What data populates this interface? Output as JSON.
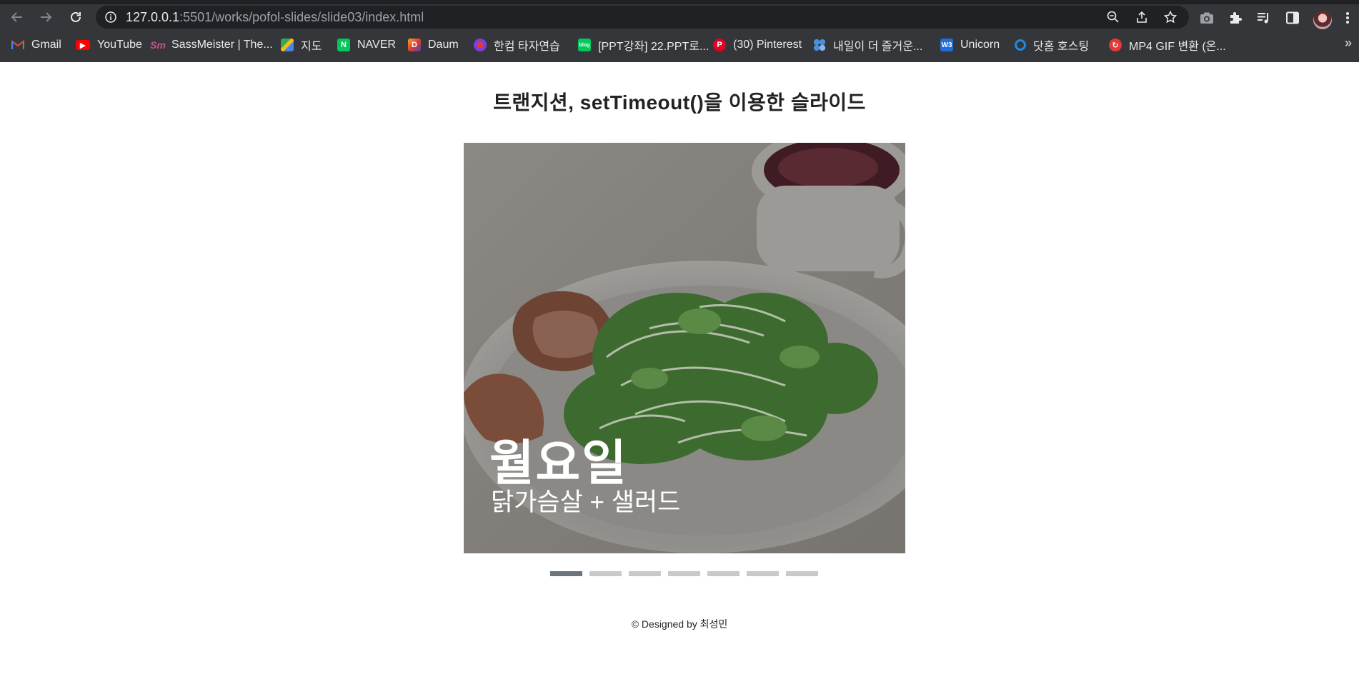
{
  "browser": {
    "url_host": "127.0.0.1",
    "url_rest": ":5501/works/pofol-slides/slide03/index.html",
    "icons": {
      "back": "arrow-left-icon",
      "forward": "arrow-right-icon",
      "reload": "reload-icon",
      "site_info": "info-icon",
      "zoom": "zoom-out-icon",
      "share": "share-icon",
      "bookmark": "star-icon",
      "screenshot": "camera-icon",
      "extensions": "puzzle-icon",
      "media": "media-queue-icon",
      "sidepanel": "side-panel-icon",
      "menu": "kebab-menu-icon"
    },
    "bookmarks": [
      {
        "label": "Gmail",
        "icon": "gmail-icon",
        "color": "#ea4335"
      },
      {
        "label": "YouTube",
        "icon": "youtube-icon",
        "color": "#ff0000"
      },
      {
        "label": "SassMeister | The...",
        "icon": "sassmeister-icon",
        "color": "#c6538c"
      },
      {
        "label": "지도",
        "icon": "google-maps-icon",
        "color": "#34a853"
      },
      {
        "label": "NAVER",
        "icon": "naver-icon",
        "color": "#03c75a"
      },
      {
        "label": "Daum",
        "icon": "daum-icon",
        "color": "#f9a825"
      },
      {
        "label": "한컴 타자연습",
        "icon": "hancom-icon",
        "color": "#7b3fe4"
      },
      {
        "label": "[PPT강좌] 22.PPT로...",
        "icon": "blog-icon",
        "color": "#03c75a"
      },
      {
        "label": "(30) Pinterest",
        "icon": "pinterest-icon",
        "color": "#e60023"
      },
      {
        "label": "내일이 더 즐거운...",
        "icon": "dots-app-icon",
        "color": "#4a90d9"
      },
      {
        "label": "Unicorn",
        "icon": "w3-icon",
        "color": "#1e6fd9"
      },
      {
        "label": "닷홈 호스팅",
        "icon": "dothome-icon",
        "color": "#1e88e5"
      },
      {
        "label": "MP4 GIF 변환 (온...",
        "icon": "convert-icon",
        "color": "#e53935"
      }
    ],
    "more": "»"
  },
  "page": {
    "title": "트랜지션, setTimeout()을 이용한 슬라이드",
    "slide": {
      "day": "월요일",
      "menu": "닭가슴살 + 샐러드"
    },
    "indicators": {
      "count": 7,
      "active_index": 0,
      "active_color": "#6c757d",
      "inactive_color": "#c7cacd"
    },
    "footer": "© Designed by 최성민"
  }
}
